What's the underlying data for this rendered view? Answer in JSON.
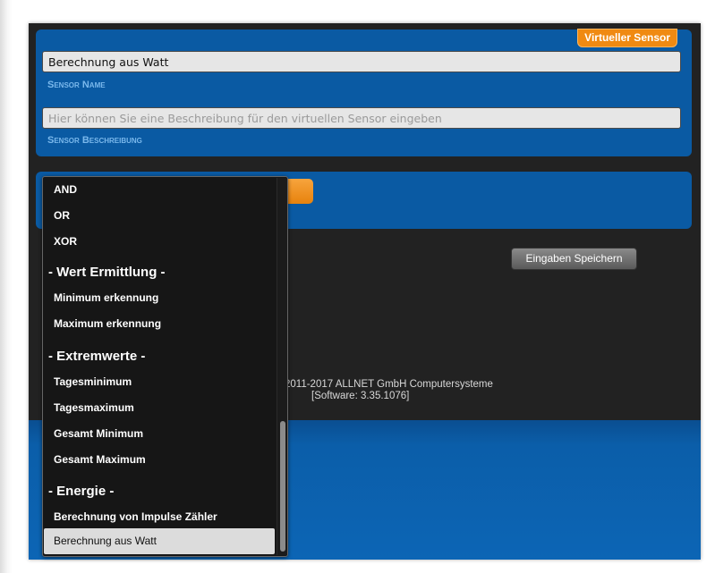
{
  "badge": "Virtueller Sensor",
  "sensor_name": {
    "value": "Berechnung aus Watt",
    "label": "Sensor Name"
  },
  "sensor_description": {
    "placeholder": "Hier können Sie eine Beschreibung für den virtuellen Sensor eingeben",
    "label": "Sensor Beschreibung"
  },
  "save_button": "Eingaben Speichern",
  "footer": {
    "line1": "2011-2017 ALLNET GmbH Computersysteme",
    "line2": "[Software: 3.35.1076]"
  },
  "dropdown": {
    "options_logic": [
      "AND",
      "OR",
      "XOR"
    ],
    "group_wert": "- Wert Ermittlung -",
    "options_wert": [
      "Minimum erkennung",
      "Maximum erkennung"
    ],
    "group_extrem": "- Extremwerte -",
    "options_extrem": [
      "Tagesminimum",
      "Tagesmaximum",
      "Gesamt Minimum",
      "Gesamt Maximum"
    ],
    "group_energie": "- Energie -",
    "option_impulse": "Berechnung von Impulse Zähler",
    "selected": "Berechnung aus Watt"
  },
  "colors": {
    "accent_orange": "#f08a12",
    "panel_blue": "#0a5aa3",
    "dark_bg": "#222222"
  }
}
